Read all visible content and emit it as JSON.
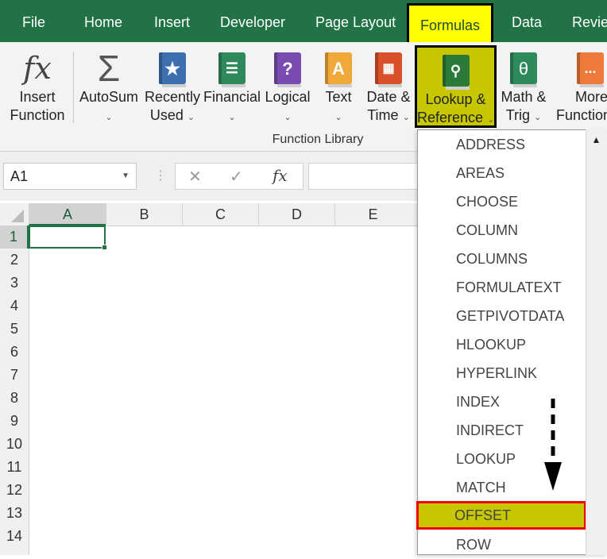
{
  "tabs": [
    "File",
    "Home",
    "Insert",
    "Developer",
    "Page Layout",
    "Formulas",
    "Data",
    "Review"
  ],
  "active_tab": "Formulas",
  "ribbon": {
    "insert_function": [
      "Insert",
      "Function"
    ],
    "autosum": [
      "AutoSum"
    ],
    "recently_used": [
      "Recently",
      "Used"
    ],
    "financial": [
      "Financial"
    ],
    "logical": [
      "Logical"
    ],
    "text": [
      "Text"
    ],
    "date_time": [
      "Date &",
      "Time"
    ],
    "lookup_reference": [
      "Lookup &",
      "Reference"
    ],
    "math_trig": [
      "Math &",
      "Trig"
    ],
    "more_functions": [
      "More",
      "Functions"
    ],
    "group_label": "Function Library",
    "icon_fx": "fx",
    "icon_sigma": "Σ",
    "icon_question": "?",
    "icon_A": "A",
    "icon_theta": "θ",
    "icon_dots": "..."
  },
  "formula_bar": {
    "name_box": "A1",
    "cancel": "✕",
    "enter": "✓",
    "fx": "fx",
    "formula": ""
  },
  "columns": [
    "A",
    "B",
    "C",
    "D",
    "E"
  ],
  "rows": [
    "1",
    "2",
    "3",
    "4",
    "5",
    "6",
    "7",
    "8",
    "9",
    "10",
    "11",
    "12",
    "13",
    "14"
  ],
  "selected_cell": "A1",
  "dropdown": {
    "items": [
      "ADDRESS",
      "AREAS",
      "CHOOSE",
      "COLUMN",
      "COLUMNS",
      "FORMULATEXT",
      "GETPIVOTDATA",
      "HLOOKUP",
      "HYPERLINK",
      "INDEX",
      "INDIRECT",
      "LOOKUP",
      "MATCH",
      "OFFSET",
      "ROW"
    ],
    "highlighted": "OFFSET"
  },
  "colors": {
    "excel_green": "#217346",
    "highlight_yellow": "#c7c700",
    "tab_yellow": "#ffff00",
    "highlight_border": "#e00000"
  }
}
